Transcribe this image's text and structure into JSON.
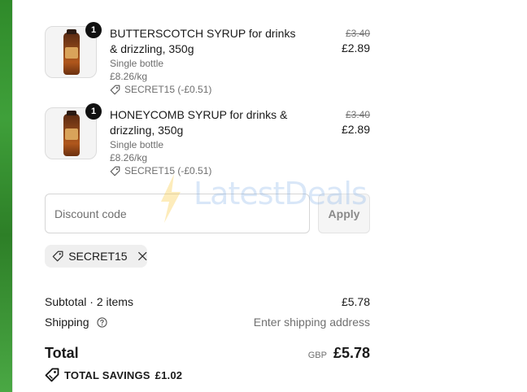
{
  "cart_items": [
    {
      "quantity": "1",
      "title": "BUTTERSCOTCH SYRUP for drinks & drizzling, 350g",
      "variant": "Single bottle",
      "unit_price": "£8.26/kg",
      "discount": "SECRET15 (-£0.51)",
      "price_original": "£3.40",
      "price_current": "£2.89"
    },
    {
      "quantity": "1",
      "title": "HONEYCOMB SYRUP for drinks & drizzling, 350g",
      "variant": "Single bottle",
      "unit_price": "£8.26/kg",
      "discount": "SECRET15 (-£0.51)",
      "price_original": "£3.40",
      "price_current": "£2.89"
    }
  ],
  "discount_form": {
    "placeholder": "Discount code",
    "apply_label": "Apply"
  },
  "watermark": "LatestDeals",
  "applied_code": "SECRET15",
  "summary": {
    "subtotal_label": "Subtotal · 2 items",
    "subtotal_value": "£5.78",
    "shipping_label": "Shipping",
    "shipping_value": "Enter shipping address",
    "total_label": "Total",
    "currency": "GBP",
    "total_value": "£5.78",
    "savings_label": "TOTAL SAVINGS",
    "savings_value": "£1.02"
  },
  "icons": {
    "tag": "tag-icon",
    "remove": "close-icon",
    "help": "help-circle-icon",
    "savings": "savings-tag-icon"
  },
  "colors": {
    "accent_green": "#3fa03a",
    "text": "#1a1a1a",
    "muted": "#707070"
  }
}
